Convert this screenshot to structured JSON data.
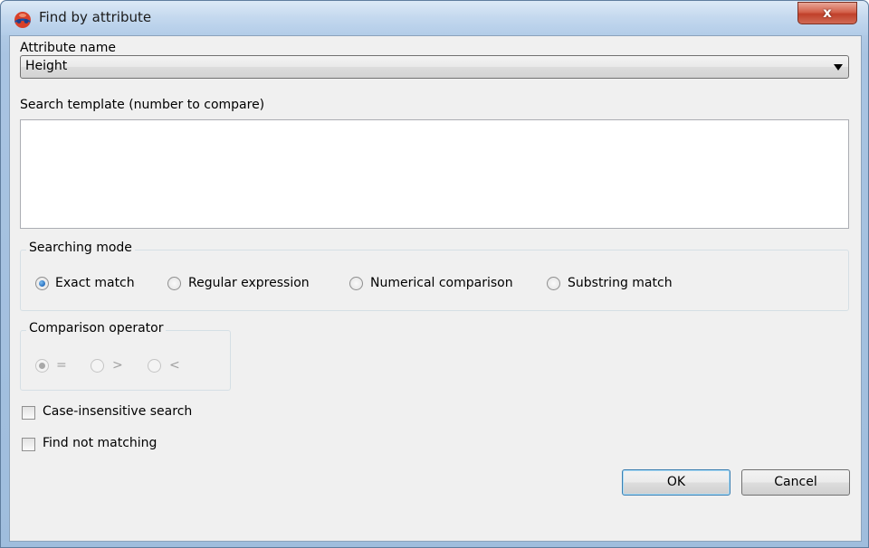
{
  "window": {
    "title": "Find by attribute",
    "close_label": "x",
    "icon": "app-globe-icon"
  },
  "attribute": {
    "label": "Attribute name",
    "selected": "Height"
  },
  "template": {
    "label": "Search template (number to compare)",
    "value": ""
  },
  "search_mode": {
    "title": "Searching mode",
    "options": [
      {
        "label": "Exact match",
        "checked": true
      },
      {
        "label": "Regular expression",
        "checked": false
      },
      {
        "label": "Numerical comparison",
        "checked": false
      },
      {
        "label": "Substring match",
        "checked": false
      }
    ]
  },
  "comparison": {
    "title": "Comparison operator",
    "enabled": false,
    "options": [
      {
        "label": "=",
        "checked": true
      },
      {
        "label": ">",
        "checked": false
      },
      {
        "label": "<",
        "checked": false
      }
    ]
  },
  "checkboxes": {
    "case_insensitive": {
      "label": "Case-insensitive search",
      "checked": false
    },
    "not_matching": {
      "label": "Find not matching",
      "checked": false
    }
  },
  "buttons": {
    "ok": "OK",
    "cancel": "Cancel"
  },
  "colors": {
    "accent": "#1b64b8",
    "close": "#c0402a"
  }
}
